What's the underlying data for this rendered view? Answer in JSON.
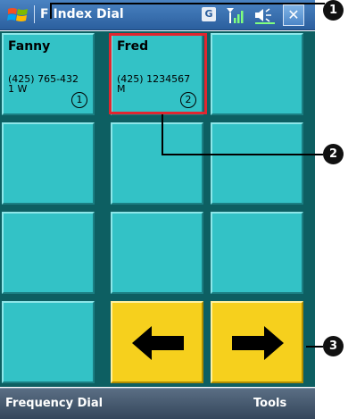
{
  "title_bar": {
    "app_title": "F Index Dial",
    "status_g": "G",
    "close": "✕"
  },
  "grid": {
    "contacts": [
      {
        "name": "Fanny",
        "phone": "(425) 765-432 1 W",
        "index": "1"
      },
      {
        "name": "Fred",
        "phone": "(425) 1234567 M",
        "index": "2"
      }
    ],
    "nav": {
      "prev_icon": "left-arrow-icon",
      "next_icon": "right-arrow-icon"
    }
  },
  "menu_bar": {
    "left": "Frequency Dial",
    "right": "Tools"
  },
  "callouts": [
    "1",
    "2",
    "3"
  ],
  "colors": {
    "tile": "#33c2c6",
    "nav_tile": "#f6d01d",
    "highlight": "#e0262f",
    "title_bar": "#2b5f9e"
  }
}
